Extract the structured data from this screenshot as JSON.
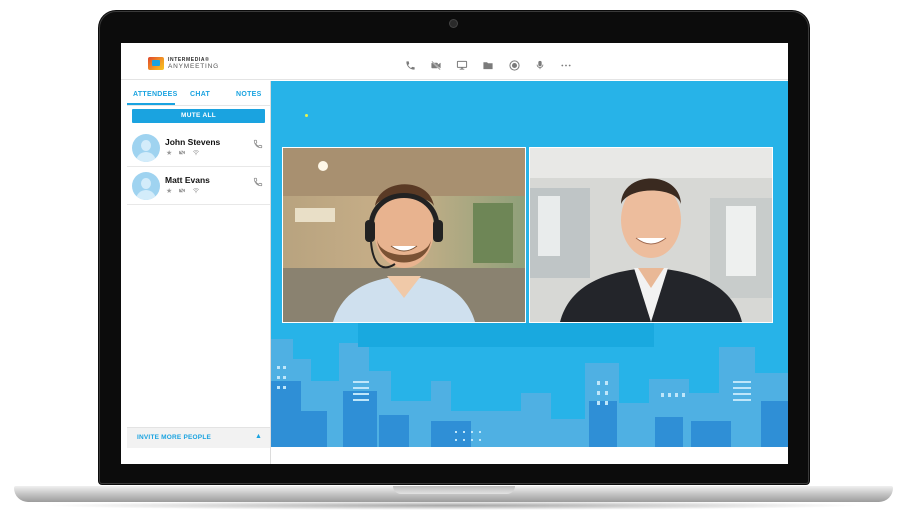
{
  "app": {
    "logo_line1": "INTERMEDIA®",
    "logo_line2": "ANYMEETING"
  },
  "toolbar": {
    "icons": [
      "phone-icon",
      "video-off-icon",
      "screen-share-icon",
      "folder-icon",
      "record-icon",
      "microphone-icon",
      "more-icon"
    ]
  },
  "sidebar": {
    "tabs": [
      {
        "label": "ATTENDEES",
        "active": true
      },
      {
        "label": "CHAT",
        "active": false
      },
      {
        "label": "NOTES",
        "active": false
      }
    ],
    "mute_all_label": "MUTE ALL",
    "attendees": [
      {
        "name": "John Stevens"
      },
      {
        "name": "Matt Evans"
      }
    ],
    "footer_label": "INVITE MORE PEOPLE"
  },
  "colors": {
    "accent": "#1aa3e0",
    "stage_background": "#27b3e8",
    "city_skyline": "#4aa6dd"
  }
}
